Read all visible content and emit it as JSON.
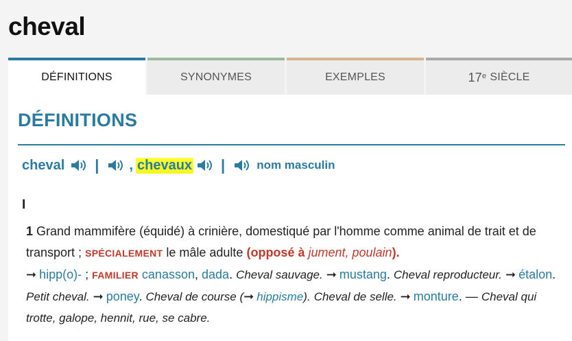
{
  "word": "cheval",
  "tabs": [
    {
      "label": "DÉFINITIONS",
      "active": true
    },
    {
      "label": "SYNONYMES",
      "active": false
    },
    {
      "label": "EXEMPLES",
      "active": false
    },
    {
      "label_num": "17",
      "label_sup": "e",
      "label_rest": "SIÈCLE",
      "active": false
    }
  ],
  "section": {
    "heading": "DÉFINITIONS"
  },
  "entry": {
    "headword": "cheval",
    "separator": "|",
    "comma": ",",
    "plural": "chevaux",
    "grammar": "nom masculin",
    "roman": "I",
    "sense": {
      "number": "1",
      "text1": "Grand mammifère (équidé) à crinière, domestiqué par l'homme comme animal de trait et de transport ;",
      "tag_special": "SPÉCIALEMENT",
      "text2": "le mâle adulte",
      "opp_open": "(opposé à",
      "opp_words": "jument, poulain",
      "opp_close": ").",
      "link_hipp": "hipp(o)-",
      "semi": ";",
      "tag_familier": "FAMILIER",
      "link_canasson": "canasson",
      "comma": ",",
      "link_dada": "dada",
      "ex1": "Cheval sauvage.",
      "link_mustang": "mustang",
      "ex2": "Cheval reproducteur.",
      "link_etalon": "étalon",
      "ex3": "Petit cheval.",
      "link_poney": "poney",
      "ex4": "Cheval de course (",
      "link_hippisme": "hippisme",
      "ex4_close": ").",
      "ex5": "Cheval de selle.",
      "link_monture": "monture",
      "dash": ". —",
      "ex6": "Cheval qui trotte, galope, hennit, rue, se cabre."
    }
  },
  "icons": {
    "speaker": "speaker-icon",
    "arrow": "right-arrow-icon"
  },
  "colors": {
    "accent": "#2a7ba0",
    "tag": "#c0392b",
    "highlight": "#ffff33"
  }
}
